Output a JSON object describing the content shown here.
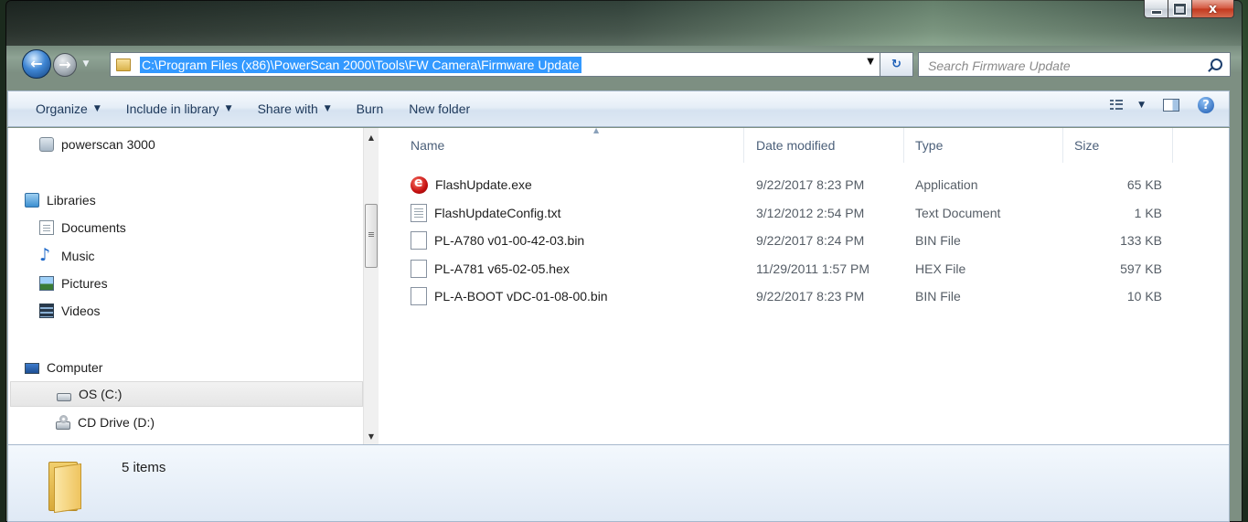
{
  "window": {
    "caption_buttons": {
      "minimize_icon": "minimize-icon",
      "maximize_icon": "maximize-icon",
      "close_glyph": "x"
    }
  },
  "navigation": {
    "address_path": "C:\\Program Files (x86)\\PowerScan 2000\\Tools\\FW Camera\\Firmware Update",
    "search_placeholder": "Search Firmware Update",
    "back_glyph": "←",
    "forward_glyph": "→",
    "refresh_glyph": "⁴↻"
  },
  "toolbar": {
    "organize": "Organize",
    "include_in_library": "Include in library",
    "share_with": "Share with",
    "burn": "Burn",
    "new_folder": "New folder",
    "caret": "▼"
  },
  "sidebar": {
    "items": [
      {
        "label": "powerscan 3000",
        "icon": "network-folder-icon"
      },
      {
        "label": "Libraries",
        "icon": "libraries-icon"
      },
      {
        "label": "Documents",
        "icon": "documents-icon"
      },
      {
        "label": "Music",
        "icon": "music-icon"
      },
      {
        "label": "Pictures",
        "icon": "pictures-icon"
      },
      {
        "label": "Videos",
        "icon": "videos-icon"
      },
      {
        "label": "Computer",
        "icon": "computer-icon"
      },
      {
        "label": "OS (C:)",
        "icon": "hard-drive-icon",
        "selected": true
      },
      {
        "label": "CD Drive (D:)",
        "icon": "cd-drive-icon"
      }
    ]
  },
  "file_list": {
    "columns": {
      "name": "Name",
      "date_modified": "Date modified",
      "type": "Type",
      "size": "Size"
    },
    "rows": [
      {
        "name": "FlashUpdate.exe",
        "date": "9/22/2017 8:23 PM",
        "type": "Application",
        "size": "65 KB",
        "icon": "application-icon"
      },
      {
        "name": "FlashUpdateConfig.txt",
        "date": "3/12/2012 2:54 PM",
        "type": "Text Document",
        "size": "1 KB",
        "icon": "text-file-icon"
      },
      {
        "name": "PL-A780 v01-00-42-03.bin",
        "date": "9/22/2017 8:24 PM",
        "type": "BIN File",
        "size": "133 KB",
        "icon": "generic-file-icon"
      },
      {
        "name": "PL-A781 v65-02-05.hex",
        "date": "11/29/2011 1:57 PM",
        "type": "HEX File",
        "size": "597 KB",
        "icon": "generic-file-icon"
      },
      {
        "name": "PL-A-BOOT vDC-01-08-00.bin",
        "date": "9/22/2017 8:23 PM",
        "type": "BIN File",
        "size": "10 KB",
        "icon": "generic-file-icon"
      }
    ]
  },
  "details": {
    "item_count": "5 items",
    "icon": "folder-icon"
  },
  "colors": {
    "selection": "#3399ff",
    "command_bar": "#dfe9f4",
    "header_text": "#4c607a"
  }
}
